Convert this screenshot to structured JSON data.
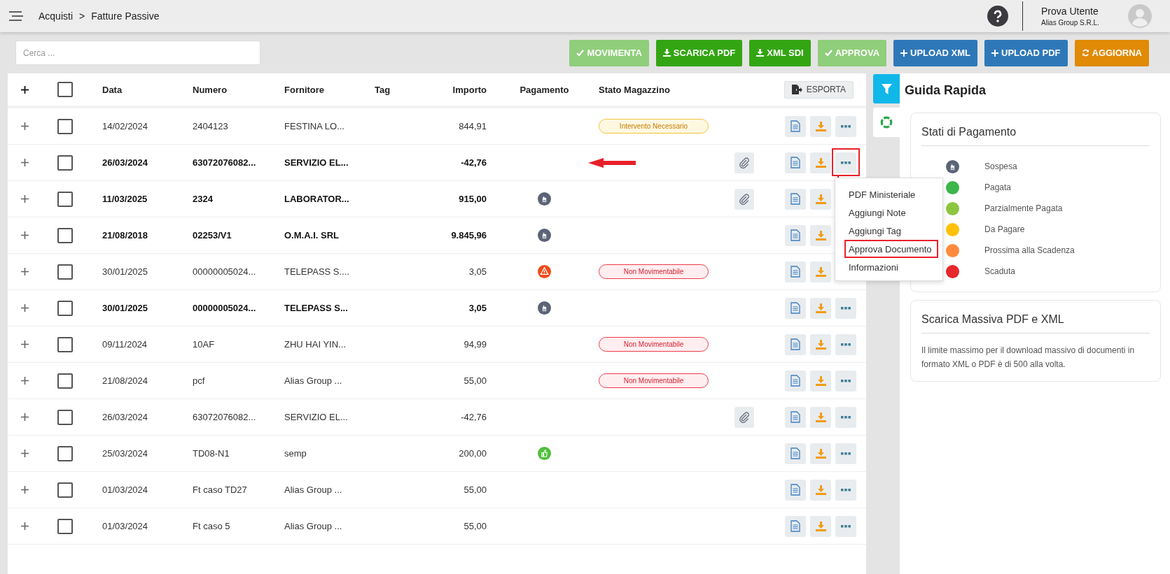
{
  "breadcrumb": [
    "Acquisti",
    ">",
    "Fatture Passive"
  ],
  "user": {
    "name": "Prova Utente",
    "company": "Alias Group S.R.L."
  },
  "search": {
    "placeholder": "Cerca ..."
  },
  "toolbar": [
    {
      "label": "MOVIMENTA",
      "disabled": true
    },
    {
      "label": "SCARICA PDF",
      "disabled": false
    },
    {
      "label": "XML SDI",
      "disabled": false
    },
    {
      "label": "APPROVA",
      "disabled": true
    },
    {
      "label": "UPLOAD XML",
      "disabled": false
    },
    {
      "label": "UPLOAD PDF",
      "disabled": false
    },
    {
      "label": "AGGIORNA",
      "disabled": false
    }
  ],
  "table": {
    "select_all": {
      "checked": false
    },
    "columns": [
      "Data",
      "Numero",
      "Fornitore",
      "Tag",
      "Importo",
      "Pagamento",
      "Stato Magazzino"
    ],
    "export_label": "ESPORTA",
    "rows": [
      {
        "date": "14/02/2024",
        "number": "2404123",
        "supplier": "FESTINA LO...",
        "amount": "844,91",
        "unread": false,
        "checked": false,
        "status": {
          "kind": "warning",
          "label": "Intervento Necessario"
        },
        "attachment": false,
        "menu_open": false,
        "pointer": false
      },
      {
        "date": "26/03/2024",
        "number": "63072076082...",
        "supplier": "SERVIZIO EL...",
        "amount": "-42,76",
        "unread": true,
        "checked": false,
        "attachment": true,
        "menu_open": true,
        "pointer": true
      },
      {
        "date": "11/03/2025",
        "number": "2324",
        "supplier": "LABORATOR...",
        "amount": "915,00",
        "unread": true,
        "checked": false,
        "payment": {
          "kind": "sospesa"
        },
        "attachment": true,
        "menu_open": false,
        "pointer": false
      },
      {
        "date": "21/08/2018",
        "number": "02253/V1",
        "supplier": "O.M.A.I. SRL",
        "amount": "9.845,96",
        "unread": true,
        "checked": false,
        "payment": {
          "kind": "sospesa"
        },
        "attachment": false,
        "menu_open": false,
        "pointer": false
      },
      {
        "date": "30/01/2025",
        "number": "00000005024...",
        "supplier": "TELEPASS S....",
        "amount": "3,05",
        "unread": false,
        "checked": false,
        "payment": {
          "kind": "warning"
        },
        "status": {
          "kind": "error",
          "label": "Non Movimentabile"
        },
        "attachment": false,
        "menu_open": false,
        "pointer": false
      },
      {
        "date": "30/01/2025",
        "number": "00000005024...",
        "supplier": "TELEPASS S...",
        "amount": "3,05",
        "unread": true,
        "checked": false,
        "payment": {
          "kind": "sospesa"
        },
        "attachment": false,
        "menu_open": false,
        "pointer": false
      },
      {
        "date": "09/11/2024",
        "number": "10AF",
        "supplier": "ZHU HAI YIN...",
        "amount": "94,99",
        "unread": false,
        "checked": false,
        "status": {
          "kind": "error",
          "label": "Non Movimentabile"
        },
        "attachment": false,
        "menu_open": false,
        "pointer": false
      },
      {
        "date": "21/08/2024",
        "number": "pcf",
        "supplier": "Alias Group ...",
        "amount": "55,00",
        "unread": false,
        "checked": false,
        "status": {
          "kind": "error",
          "label": "Non Movimentabile"
        },
        "attachment": false,
        "menu_open": false,
        "pointer": false
      },
      {
        "date": "26/03/2024",
        "number": "63072076082...",
        "supplier": "SERVIZIO EL...",
        "amount": "-42,76",
        "unread": false,
        "checked": false,
        "attachment": true,
        "menu_open": false,
        "pointer": false
      },
      {
        "date": "25/03/2024",
        "number": "TD08-N1",
        "supplier": "semp",
        "amount": "200,00",
        "unread": false,
        "checked": false,
        "payment": {
          "kind": "pagata"
        },
        "attachment": false,
        "menu_open": false,
        "pointer": false
      },
      {
        "date": "01/03/2024",
        "number": "Ft caso TD27",
        "supplier": "Alias Group ...",
        "amount": "55,00",
        "unread": false,
        "checked": false,
        "attachment": false,
        "menu_open": false,
        "pointer": false
      },
      {
        "date": "01/03/2024",
        "number": "Ft caso 5",
        "supplier": "Alias Group ...",
        "amount": "55,00",
        "unread": false,
        "checked": false,
        "attachment": false,
        "menu_open": false,
        "pointer": false
      }
    ]
  },
  "context_menu": [
    {
      "label": "PDF Ministeriale",
      "highlighted": false
    },
    {
      "label": "Aggiungi Note",
      "highlighted": false
    },
    {
      "label": "Aggiungi Tag",
      "highlighted": false
    },
    {
      "label": "Approva Documento",
      "highlighted": true
    },
    {
      "label": "Informazioni",
      "highlighted": false
    }
  ],
  "side_tabs": [
    {
      "kind": "filter",
      "selected": false
    },
    {
      "kind": "help",
      "selected": true
    }
  ],
  "guide": {
    "title": "Guida Rapida",
    "payment_states": {
      "title": "Stati di Pagamento",
      "items": [
        {
          "kind": "icon",
          "label": "Sospesa"
        },
        {
          "kind": "dot",
          "label": "Pagata",
          "color": "#3cb54a"
        },
        {
          "kind": "dot",
          "label": "Parzialmente Pagata",
          "color": "#8cc63f"
        },
        {
          "kind": "dot",
          "label": "Da Pagare",
          "color": "#ffc107"
        },
        {
          "kind": "dot",
          "label": "Prossima alla Scadenza",
          "color": "#ff8a3d"
        },
        {
          "kind": "dot",
          "label": "Scaduta",
          "color": "#e8272b"
        }
      ]
    },
    "bulk": {
      "title": "Scarica Massiva PDF e XML",
      "text": "Il limite massimo per il download massivo di documenti in formato XML o PDF è di 500 alla volta."
    }
  }
}
